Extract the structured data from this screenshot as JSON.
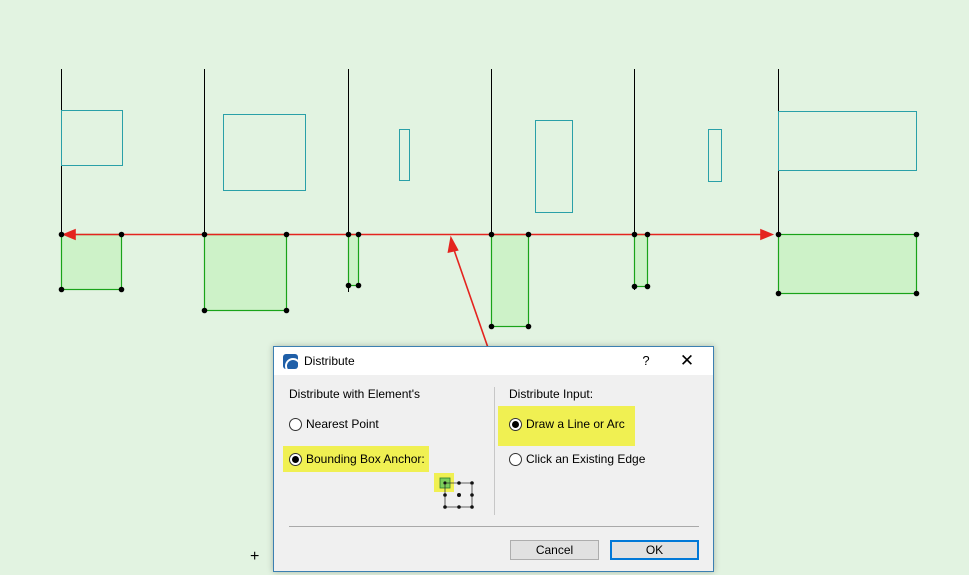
{
  "dialog": {
    "title": "Distribute",
    "help_label": "?",
    "close_label": "✕",
    "icon": "archicad-icon",
    "distribute_with": {
      "heading": "Distribute with Element's",
      "options": [
        {
          "label": "Nearest Point",
          "selected": false
        },
        {
          "label": "Bounding Box Anchor:",
          "selected": true
        }
      ]
    },
    "distribute_input": {
      "heading": "Distribute Input:",
      "options": [
        {
          "label": "Draw a Line or Arc",
          "selected": true
        },
        {
          "label": "Click an Existing Edge",
          "selected": false
        }
      ]
    },
    "cancel_label": "Cancel",
    "ok_label": "OK"
  },
  "cursor": {
    "label": "+"
  },
  "colors": {
    "background": "#e2f3e1",
    "element_outline": "#2aa0a8",
    "distributed_fill": "#cdf2c8",
    "distributed_outline": "#19a319",
    "distribution_line": "#e4241f",
    "highlight": "#f0f052",
    "dialog_border": "#3c7fb1",
    "default_button_border": "#0078d7"
  }
}
